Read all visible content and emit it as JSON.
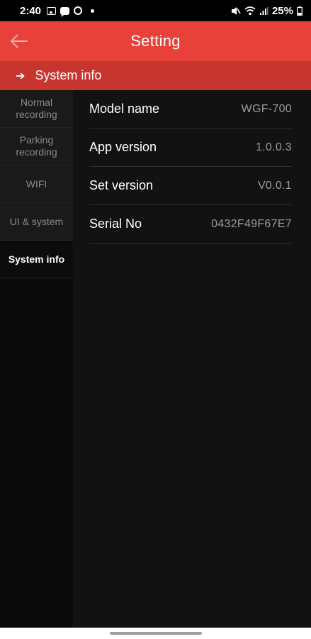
{
  "status_bar": {
    "time": "2:40",
    "battery": "25%"
  },
  "app_bar": {
    "title": "Setting",
    "back_icon": "arrow-left-icon"
  },
  "section": {
    "arrow_icon": "arrow-right-icon",
    "title": "System info"
  },
  "sidebar": {
    "items": [
      {
        "label": "Normal recording",
        "active": false
      },
      {
        "label": "Parking recording",
        "active": false
      },
      {
        "label": "WIFI",
        "active": false
      },
      {
        "label": "UI & system",
        "active": false
      },
      {
        "label": "System info",
        "active": true
      }
    ]
  },
  "info": {
    "rows": [
      {
        "label": "Model name",
        "value": "WGF-700"
      },
      {
        "label": "App version",
        "value": "1.0.0.3"
      },
      {
        "label": "Set version",
        "value": "V0.0.1"
      },
      {
        "label": "Serial No",
        "value": "0432F49F67E7"
      }
    ]
  },
  "colors": {
    "app_bar": "#e8413a",
    "section_header": "#c8342e",
    "background": "#121212"
  }
}
